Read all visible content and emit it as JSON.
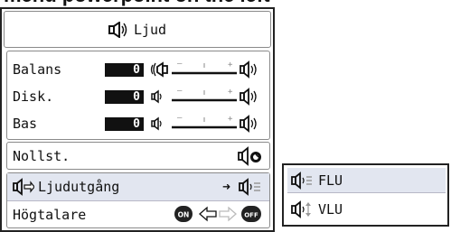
{
  "header_partial_text": "menu powerpoint on the left",
  "menu": {
    "title": "Ljud",
    "title_icon": "speaker-icon",
    "adjustments": [
      {
        "label": "Balans",
        "value": "0",
        "left_icon": "speaker-left-icon",
        "right_icon": "speaker-right-icon"
      },
      {
        "label": "Disk.",
        "value": "0",
        "left_icon": "speaker-low-icon",
        "right_icon": "speaker-high-icon"
      },
      {
        "label": "Bas",
        "value": "0",
        "left_icon": "speaker-low-icon",
        "right_icon": "speaker-high-icon"
      }
    ],
    "reset": {
      "label": "Nollst.",
      "icon": "reset-icon"
    },
    "audio_output": {
      "label": "Ljudutgång",
      "icon": "audio-output-icon",
      "arrow": "➜"
    },
    "speaker": {
      "label": "Högtalare",
      "on_label": "ON",
      "off_label": "OFF"
    }
  },
  "submenu": {
    "items": [
      {
        "label": "FLU",
        "icon": "audio-fixed-icon",
        "selected": true
      },
      {
        "label": "VLU",
        "icon": "audio-variable-icon",
        "selected": false
      }
    ]
  },
  "colors": {
    "highlight": "#e2e6f0",
    "value_box": "#111111",
    "panel_border": "#222222"
  }
}
